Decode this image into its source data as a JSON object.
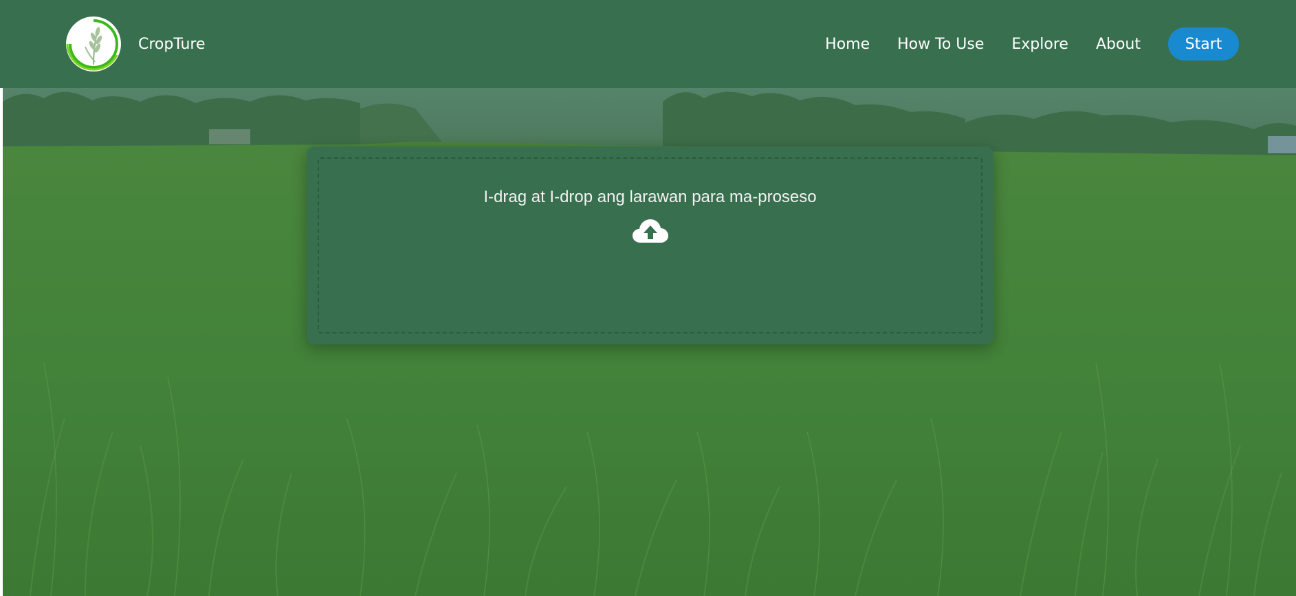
{
  "brand": {
    "name": "CropTure",
    "logo_icon": "rice-stalk-logo-icon"
  },
  "nav": {
    "items": [
      {
        "label": "Home"
      },
      {
        "label": "How To Use"
      },
      {
        "label": "Explore"
      },
      {
        "label": "About"
      }
    ],
    "start_label": "Start"
  },
  "upload": {
    "prompt": "I-drag at I-drop ang larawan para ma-proseso",
    "icon": "cloud-upload-icon"
  },
  "colors": {
    "header_bg": "#38704f",
    "card_bg": "#38704f",
    "start_button": "#1a8ad0",
    "text": "#ffffff"
  }
}
